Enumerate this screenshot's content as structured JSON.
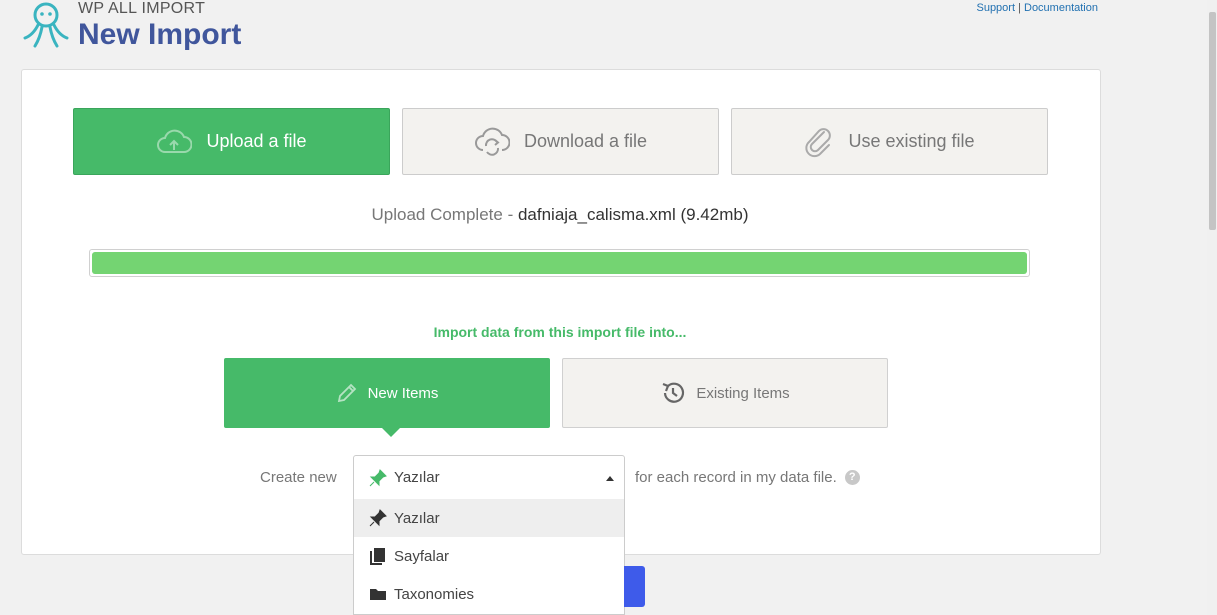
{
  "header": {
    "brand": "WP ALL IMPORT",
    "title": "New Import",
    "support_label": "Support",
    "separator": "|",
    "documentation_label": "Documentation"
  },
  "source_tabs": [
    {
      "label": "Upload a file",
      "icon": "cloud-upload-icon",
      "active": true
    },
    {
      "label": "Download a file",
      "icon": "cloud-sync-icon",
      "active": false
    },
    {
      "label": "Use existing file",
      "icon": "paperclip-icon",
      "active": false
    }
  ],
  "upload": {
    "status": "Upload Complete",
    "dash": " - ",
    "filename": "dafniaja_calisma.xml (9.42mb)",
    "progress_percent": 100
  },
  "import_target": {
    "label": "Import data from this import file into...",
    "new_items": "New Items",
    "existing_items": "Existing Items"
  },
  "create": {
    "prefix": "Create new",
    "selected": "Yazılar",
    "suffix": "for each record in my data file.",
    "help": "?",
    "options": [
      {
        "label": "Yazılar",
        "icon": "pushpin-icon"
      },
      {
        "label": "Sayfalar",
        "icon": "pages-icon"
      },
      {
        "label": "Taxonomies",
        "icon": "folder-icon"
      }
    ]
  },
  "colors": {
    "accent_green": "#46ba69",
    "progress_green": "#74d472",
    "brand_blue": "#40569c",
    "button_blue": "#3e5bea"
  }
}
